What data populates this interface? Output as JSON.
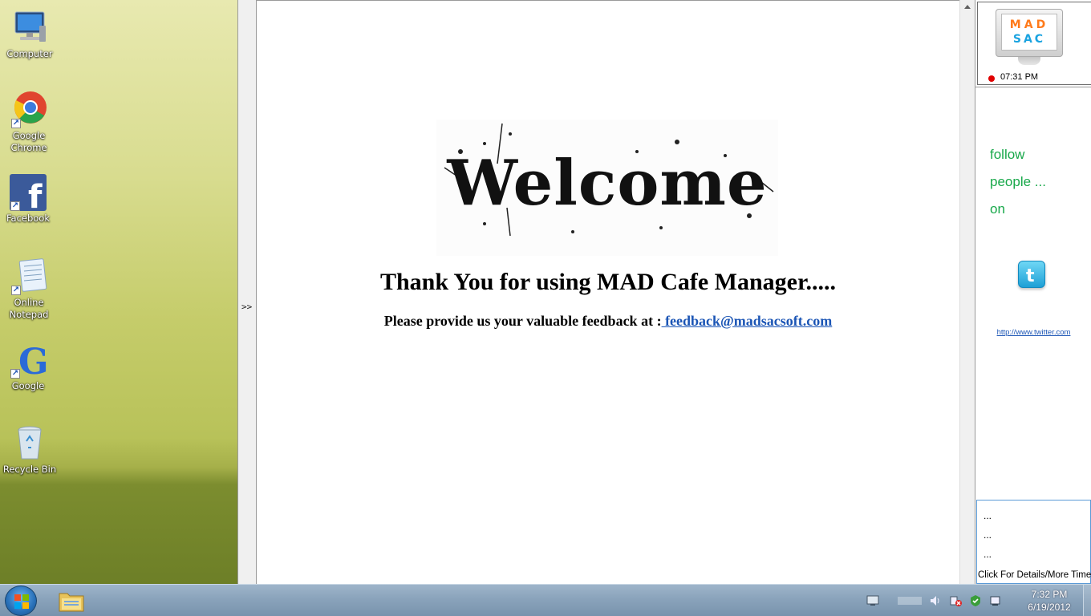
{
  "desktop": {
    "icons": [
      {
        "label": "Computer"
      },
      {
        "label": "Google\nChrome"
      },
      {
        "label": "Facebook"
      },
      {
        "label": "Online\nNotepad"
      },
      {
        "label": "Google"
      },
      {
        "label": "Recycle Bin"
      }
    ]
  },
  "splitter": {
    "toggle_label": ">>"
  },
  "main": {
    "banner_text": "Welcome",
    "thank_you": "Thank You for using MAD Cafe Manager.....",
    "feedback_prompt": "Please provide us your valuable feedback at :",
    "feedback_email": " feedback@madsacsoft.com"
  },
  "right_panel": {
    "logo_line1": "MAD",
    "logo_line2": "SAC",
    "time": "07:31 PM",
    "follow_lines": [
      "follow",
      "people ...",
      "on"
    ],
    "twitter_link": "http://www.twitter.com",
    "details_dots": [
      "...",
      "...",
      "..."
    ],
    "details_label": "Click For Details/More Time"
  },
  "taskbar": {
    "clock_time": "7:32 PM",
    "clock_date": "6/19/2012"
  },
  "colors": {
    "accent_green": "#18a84a",
    "link_blue": "#1b55b5",
    "status_red": "#e00000"
  }
}
